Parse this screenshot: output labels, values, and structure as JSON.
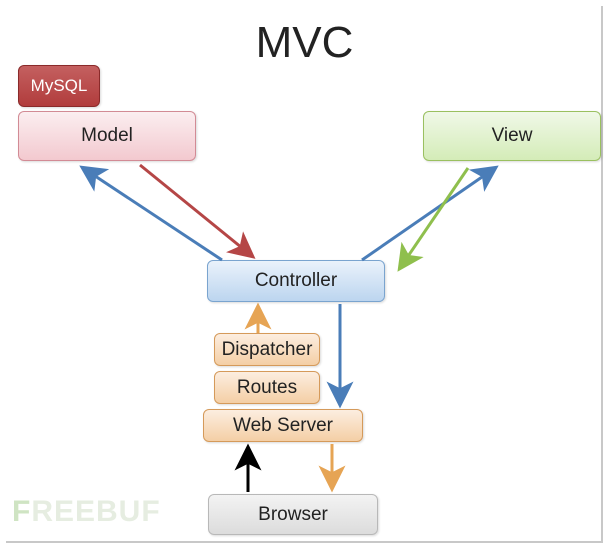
{
  "title": "MVC",
  "nodes": {
    "mysql": "MySQL",
    "model": "Model",
    "view": "View",
    "controller": "Controller",
    "dispatcher": "Dispatcher",
    "routes": "Routes",
    "webserver": "Web Server",
    "browser": "Browser"
  },
  "colors": {
    "blue": "#4a7db8",
    "red": "#b54646",
    "green": "#8fbf4d",
    "orange": "#e6a454",
    "black": "#000000"
  },
  "edges": [
    {
      "from": "controller",
      "to": "model",
      "color": "blue"
    },
    {
      "from": "model",
      "to": "controller",
      "color": "red"
    },
    {
      "from": "controller",
      "to": "view",
      "color": "blue"
    },
    {
      "from": "view",
      "to": "controller",
      "color": "green"
    },
    {
      "from": "dispatcher",
      "to": "controller",
      "color": "orange"
    },
    {
      "from": "controller",
      "to": "webserver",
      "color": "blue"
    },
    {
      "from": "browser",
      "to": "webserver",
      "color": "black"
    },
    {
      "from": "webserver",
      "to": "browser",
      "color": "orange"
    }
  ],
  "watermark": "FREEBUF"
}
